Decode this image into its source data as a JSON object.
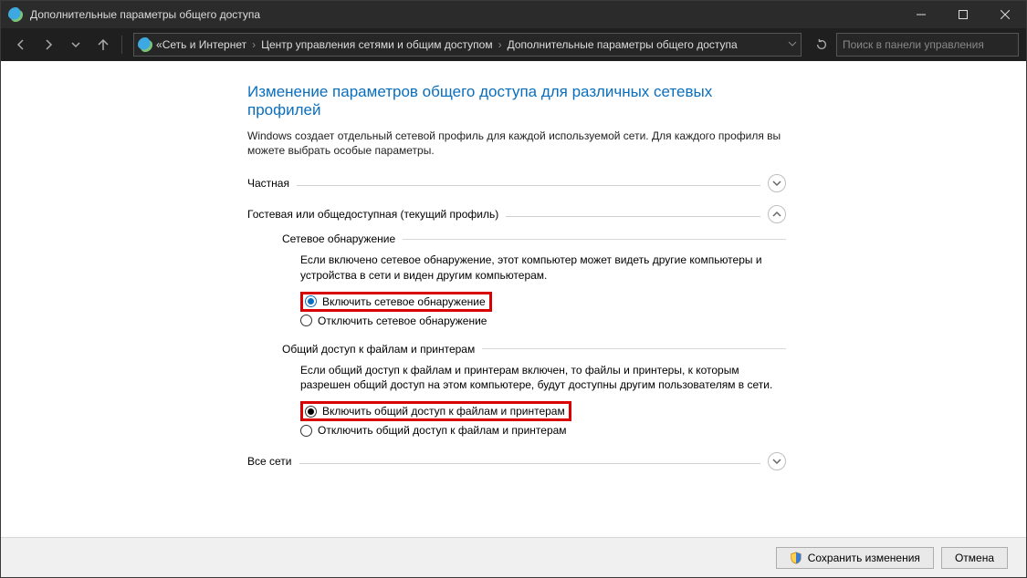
{
  "window": {
    "title": "Дополнительные параметры общего доступа"
  },
  "breadcrumb": {
    "prefix": "«",
    "items": [
      "Сеть и Интернет",
      "Центр управления сетями и общим доступом",
      "Дополнительные параметры общего доступа"
    ]
  },
  "search": {
    "placeholder": "Поиск в панели управления"
  },
  "page": {
    "title": "Изменение параметров общего доступа для различных сетевых профилей",
    "description": "Windows создает отдельный сетевой профиль для каждой используемой сети. Для каждого профиля вы можете выбрать особые параметры."
  },
  "profiles": {
    "private": {
      "label": "Частная"
    },
    "guest": {
      "label": "Гостевая или общедоступная (текущий профиль)",
      "network_discovery": {
        "title": "Сетевое обнаружение",
        "text": "Если включено сетевое обнаружение, этот компьютер может видеть другие компьютеры и устройства в сети и виден другим компьютерам.",
        "enable": "Включить сетевое обнаружение",
        "disable": "Отключить сетевое обнаружение"
      },
      "file_sharing": {
        "title": "Общий доступ к файлам и принтерам",
        "text": "Если общий доступ к файлам и принтерам включен, то файлы и принтеры, к которым разрешен общий доступ на этом компьютере, будут доступны другим пользователям в сети.",
        "enable": "Включить общий доступ к файлам и принтерам",
        "disable": "Отключить общий доступ к файлам и принтерам"
      }
    },
    "all": {
      "label": "Все сети"
    }
  },
  "footer": {
    "save": "Сохранить изменения",
    "cancel": "Отмена"
  }
}
